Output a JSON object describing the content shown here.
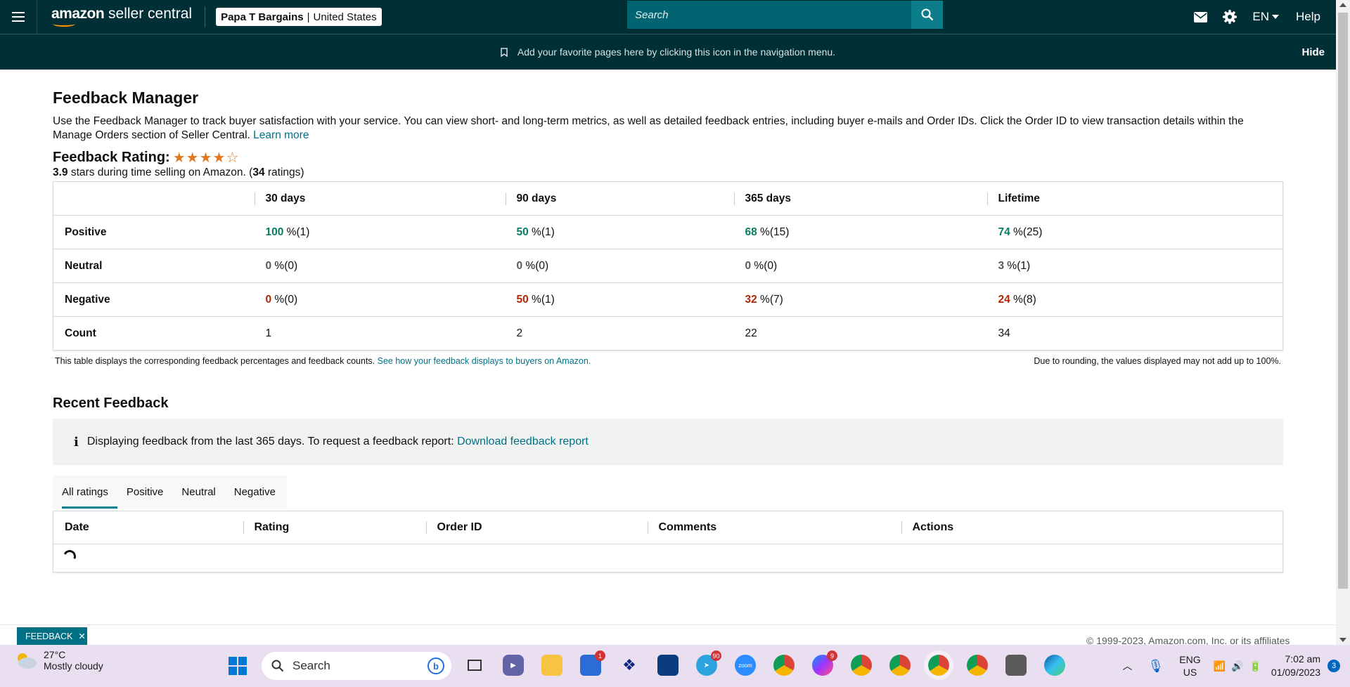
{
  "header": {
    "logo_amazon": "amazon",
    "logo_rest": " seller central",
    "store_name": "Papa T Bargains",
    "store_sep": "|",
    "store_region": "United States",
    "search_placeholder": "Search",
    "language": "EN",
    "help": "Help"
  },
  "favbar": {
    "message": "Add your favorite pages here by clicking this icon in the navigation menu.",
    "hide": "Hide"
  },
  "page": {
    "title": "Feedback Manager",
    "intro": "Use the Feedback Manager to track buyer satisfaction with your service. You can view short- and long-term metrics, as well as detailed feedback entries, including buyer e-mails and Order IDs. Click the Order ID to view transaction details within the Manage Orders section of Seller Central.",
    "learn_more": "Learn more"
  },
  "rating": {
    "label": "Feedback Rating:",
    "stars_filled": 4,
    "stars_total": 5,
    "value": "3.9",
    "text_mid": " stars during time selling on Amazon. (",
    "count": "34",
    "text_end": " ratings)"
  },
  "metrics": {
    "columns": [
      "",
      "30 days",
      "90 days",
      "365 days",
      "Lifetime"
    ],
    "rows": [
      {
        "label": "Positive",
        "kind": "pos",
        "cells": [
          {
            "pct": "100",
            "rest": " %(1)"
          },
          {
            "pct": "50",
            "rest": " %(1)"
          },
          {
            "pct": "68",
            "rest": " %(15)"
          },
          {
            "pct": "74",
            "rest": " %(25)"
          }
        ]
      },
      {
        "label": "Neutral",
        "kind": "neu",
        "cells": [
          {
            "pct": "0",
            "rest": " %(0)"
          },
          {
            "pct": "0",
            "rest": " %(0)"
          },
          {
            "pct": "0",
            "rest": " %(0)"
          },
          {
            "pct": "3",
            "rest": " %(1)"
          }
        ]
      },
      {
        "label": "Negative",
        "kind": "neg",
        "cells": [
          {
            "pct": "0",
            "rest": " %(0)"
          },
          {
            "pct": "50",
            "rest": " %(1)"
          },
          {
            "pct": "32",
            "rest": " %(7)"
          },
          {
            "pct": "24",
            "rest": " %(8)"
          }
        ]
      },
      {
        "label": "Count",
        "kind": "count",
        "cells": [
          {
            "pct": "",
            "rest": "1"
          },
          {
            "pct": "",
            "rest": "2"
          },
          {
            "pct": "",
            "rest": "22"
          },
          {
            "pct": "",
            "rest": "34"
          }
        ]
      }
    ],
    "note_left": "This table displays the corresponding feedback percentages and feedback counts.",
    "note_link": "See how your feedback displays to buyers on Amazon.",
    "note_right": "Due to rounding, the values displayed may not add up to 100%."
  },
  "recent": {
    "title": "Recent Feedback",
    "info_text": "Displaying feedback from the last 365 days. To request a feedback report:",
    "info_link": "Download feedback report",
    "tabs": [
      "All ratings",
      "Positive",
      "Neutral",
      "Negative"
    ],
    "active_tab": 0,
    "columns": [
      "Date",
      "Rating",
      "Order ID",
      "Comments",
      "Actions"
    ]
  },
  "footer": {
    "feedback_tab": "FEEDBACK",
    "copyright_partial": "© 1999-2023, Amazon.com, Inc. or its affiliates"
  },
  "taskbar": {
    "temperature": "27°C",
    "weather": "Mostly cloudy",
    "search": "Search",
    "lang_top": "ENG",
    "lang_bottom": "US",
    "time": "7:02 am",
    "date": "01/09/2023",
    "notifications": "3",
    "badges": {
      "store": "1",
      "telegram": "90",
      "messenger": "9"
    }
  },
  "colors": {
    "nav_bg": "#002f36",
    "search_bg": "#006570",
    "link": "#007185",
    "positive": "#067d62",
    "negative": "#b12704",
    "star": "#de7921"
  }
}
